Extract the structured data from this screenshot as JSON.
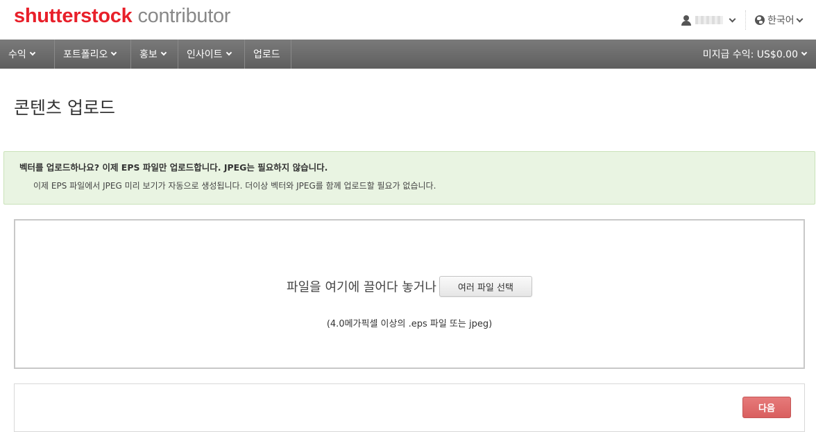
{
  "header": {
    "logo_brand": "shutterstock",
    "logo_sub": "contributor",
    "language": "한국어"
  },
  "nav": {
    "items": [
      {
        "label": "수익",
        "has_dropdown": true
      },
      {
        "label": "포트폴리오",
        "has_dropdown": true
      },
      {
        "label": "홍보",
        "has_dropdown": true
      },
      {
        "label": "인사이트",
        "has_dropdown": true
      },
      {
        "label": "업로드",
        "has_dropdown": false
      }
    ],
    "unpaid_earnings": "미지급 수익: US$0.00"
  },
  "page": {
    "title": "콘텐츠 업로드"
  },
  "notice": {
    "title": "벡터를 업로드하나요? 이제 EPS 파일만 업로드합니다. JPEG는 필요하지 않습니다.",
    "body": "이제 EPS 파일에서 JPEG 미리 보기가 자동으로 생성됩니다. 더이상 벡터와 JPEG를 함께 업로드할 필요가 없습니다."
  },
  "dropzone": {
    "prompt": "파일을 여기에 끌어다 놓거나",
    "button_label": "여러 파일 선택",
    "hint": "(4.0메가픽셀 이상의 .eps 파일 또는 jpeg)"
  },
  "footer": {
    "next_label": "다음"
  },
  "colors": {
    "brand_red": "#e8202a",
    "nav_bg": "#6b6b6b",
    "notice_bg": "#e9f4e2",
    "next_button": "#d95f5f"
  }
}
